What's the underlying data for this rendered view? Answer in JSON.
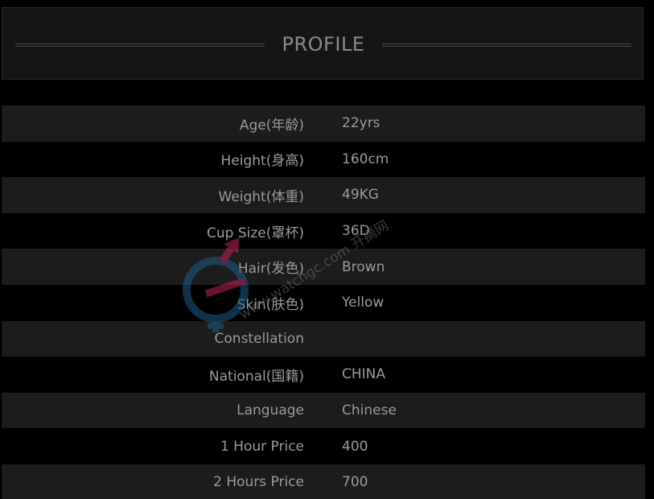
{
  "header": {
    "title": "PROFILE"
  },
  "profile": {
    "rows": [
      {
        "label": "Age(年龄)",
        "value": "22yrs"
      },
      {
        "label": "Height(身高)",
        "value": "160cm"
      },
      {
        "label": "Weight(体重)",
        "value": "49KG"
      },
      {
        "label": "Cup Size(罩杯)",
        "value": "36D"
      },
      {
        "label": "Hair(发色)",
        "value": "Brown"
      },
      {
        "label": "Skin(肤色)",
        "value": "Yellow"
      },
      {
        "label": "Constellation",
        "value": ""
      },
      {
        "label": "National(国籍)",
        "value": "CHINA"
      },
      {
        "label": "Language",
        "value": "Chinese"
      },
      {
        "label": "1 Hour Price",
        "value": "400"
      },
      {
        "label": "2 Hours Price",
        "value": "700"
      }
    ]
  },
  "watermark": {
    "text": "www.watchgc.com 开摘网",
    "icon": "gender-symbol-icon"
  },
  "colors": {
    "background": "#000000",
    "shaded_row": "#1c1c1c",
    "text": "#9a9a9a",
    "watermark_pink": "#c0245a",
    "watermark_blue": "#1d5a86"
  }
}
